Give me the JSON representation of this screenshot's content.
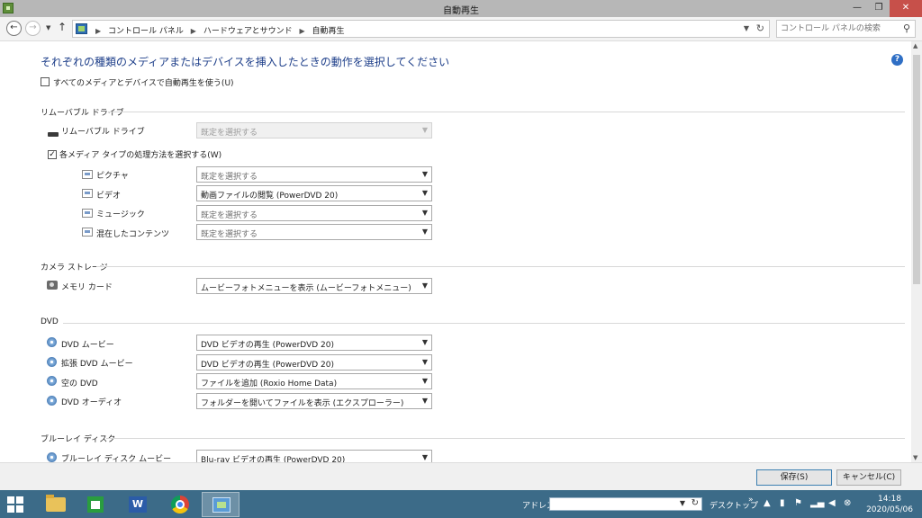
{
  "window": {
    "title": "自動再生",
    "minimize": "—",
    "maximize": "❐",
    "close": "✕"
  },
  "nav": {
    "back": "←",
    "forward": "→",
    "up": "↑",
    "breadcrumbs": [
      "コントロール パネル",
      "ハードウェアとサウンド",
      "自動再生"
    ],
    "search_placeholder": "コントロール パネルの検索"
  },
  "heading": "それぞれの種類のメディアまたはデバイスを挿入したときの動作を選択してください",
  "help": "?",
  "use_autoplay": {
    "label": "すべてのメディアとデバイスで自動再生を使う(U)",
    "checked": false
  },
  "sections": {
    "removable": {
      "title": "リムーバブル ドライブ",
      "drive": {
        "label": "リムーバブル ドライブ",
        "value": "既定を選択する",
        "disabled": true
      },
      "per_type": {
        "label": "各メディア タイプの処理方法を選択する(W)",
        "checked": true
      },
      "types": [
        {
          "label": "ピクチャ",
          "value": "既定を選択する",
          "icon": "picture-icon"
        },
        {
          "label": "ビデオ",
          "value": "動画ファイルの閲覧 (PowerDVD 20)",
          "icon": "video-icon"
        },
        {
          "label": "ミュージック",
          "value": "既定を選択する",
          "icon": "music-icon"
        },
        {
          "label": "混在したコンテンツ",
          "value": "既定を選択する",
          "icon": "mixed-content-icon"
        }
      ]
    },
    "camera": {
      "title": "カメラ ストレージ",
      "items": [
        {
          "label": "メモリ カード",
          "value": "ムービーフォトメニューを表示 (ムービーフォトメニュー)"
        }
      ]
    },
    "dvd": {
      "title": "DVD",
      "items": [
        {
          "label": "DVD ムービー",
          "value": "DVD ビデオの再生 (PowerDVD 20)"
        },
        {
          "label": "拡張 DVD ムービー",
          "value": "DVD ビデオの再生 (PowerDVD 20)"
        },
        {
          "label": "空の DVD",
          "value": "ファイルを追加 (Roxio Home Data)"
        },
        {
          "label": "DVD オーディオ",
          "value": "フォルダーを開いてファイルを表示 (エクスプローラー)"
        }
      ]
    },
    "bluray": {
      "title": "ブルーレイ ディスク",
      "items": [
        {
          "label": "ブルーレイ ディスク ムービー",
          "value": "Blu-ray ビデオの再生 (PowerDVD 20)"
        }
      ]
    }
  },
  "buttons": {
    "save": "保存(S)",
    "cancel": "キャンセル(C)"
  },
  "taskbar": {
    "address_label": "アドレス",
    "desktop_label": "デスクトップ",
    "more": "»",
    "time": "14:18",
    "date": "2020/05/06"
  }
}
